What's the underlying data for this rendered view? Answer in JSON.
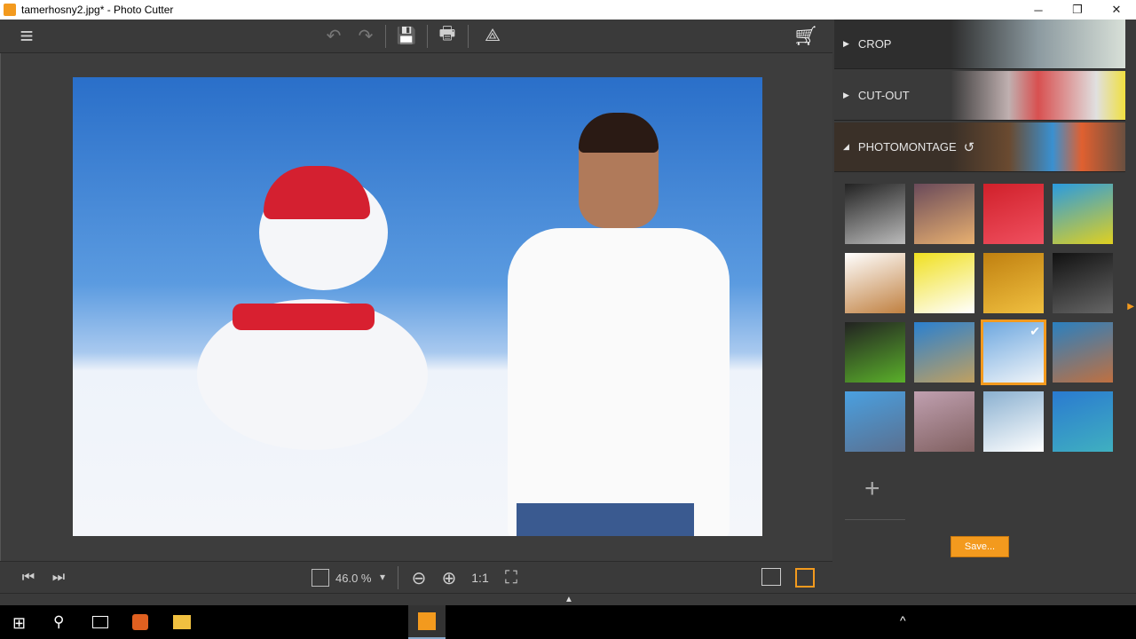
{
  "window": {
    "title": "tamerhosny2.jpg* - Photo Cutter",
    "minimize": "─",
    "restore": "❐",
    "close": "✕"
  },
  "toolbar": {
    "menu": "≡",
    "undo": "↶",
    "redo": "↷",
    "save": "💾",
    "print": "🖶",
    "share": "⟁",
    "cart": "🛒"
  },
  "panel": {
    "sections": [
      {
        "label": "CROP",
        "arrow": "▶"
      },
      {
        "label": "CUT-OUT",
        "arrow": "▶"
      },
      {
        "label": "PHOTOMONTAGE",
        "arrow": "◢",
        "reset": "↺"
      }
    ],
    "thumbs": [
      "#222,#bbb",
      "#6a4a5a,#e8b070",
      "#d0202a,#f05060",
      "#2a9be0,#e0d020",
      "#ffffff,#c08040",
      "#f0e020,#ffffff",
      "#c08010,#f0c040",
      "#111,#666",
      "#222,#5ab02a",
      "#2a80d0,#c0a060",
      "#6ea8e0,#f0f4f8",
      "#2a80c0,#c07040",
      "#4aa0e0,#5a7090",
      "#c0a0b0,#806060",
      "#8ab0d0,#ffffff",
      "#2a7ad0,#40b0c0"
    ],
    "selected_index": 10,
    "check": "✔",
    "add": "+",
    "save_label": "Save..."
  },
  "bottombar": {
    "first": "⏮",
    "last": "⏭",
    "zoom_value": "46.0 %",
    "dropdown": "▾",
    "zoom_out": "⊖",
    "zoom_in": "⊕",
    "actual_size": "1:1",
    "fit": "⛶"
  },
  "colors": {
    "accent": "#f39a1e",
    "background": "#3a3a3a"
  }
}
